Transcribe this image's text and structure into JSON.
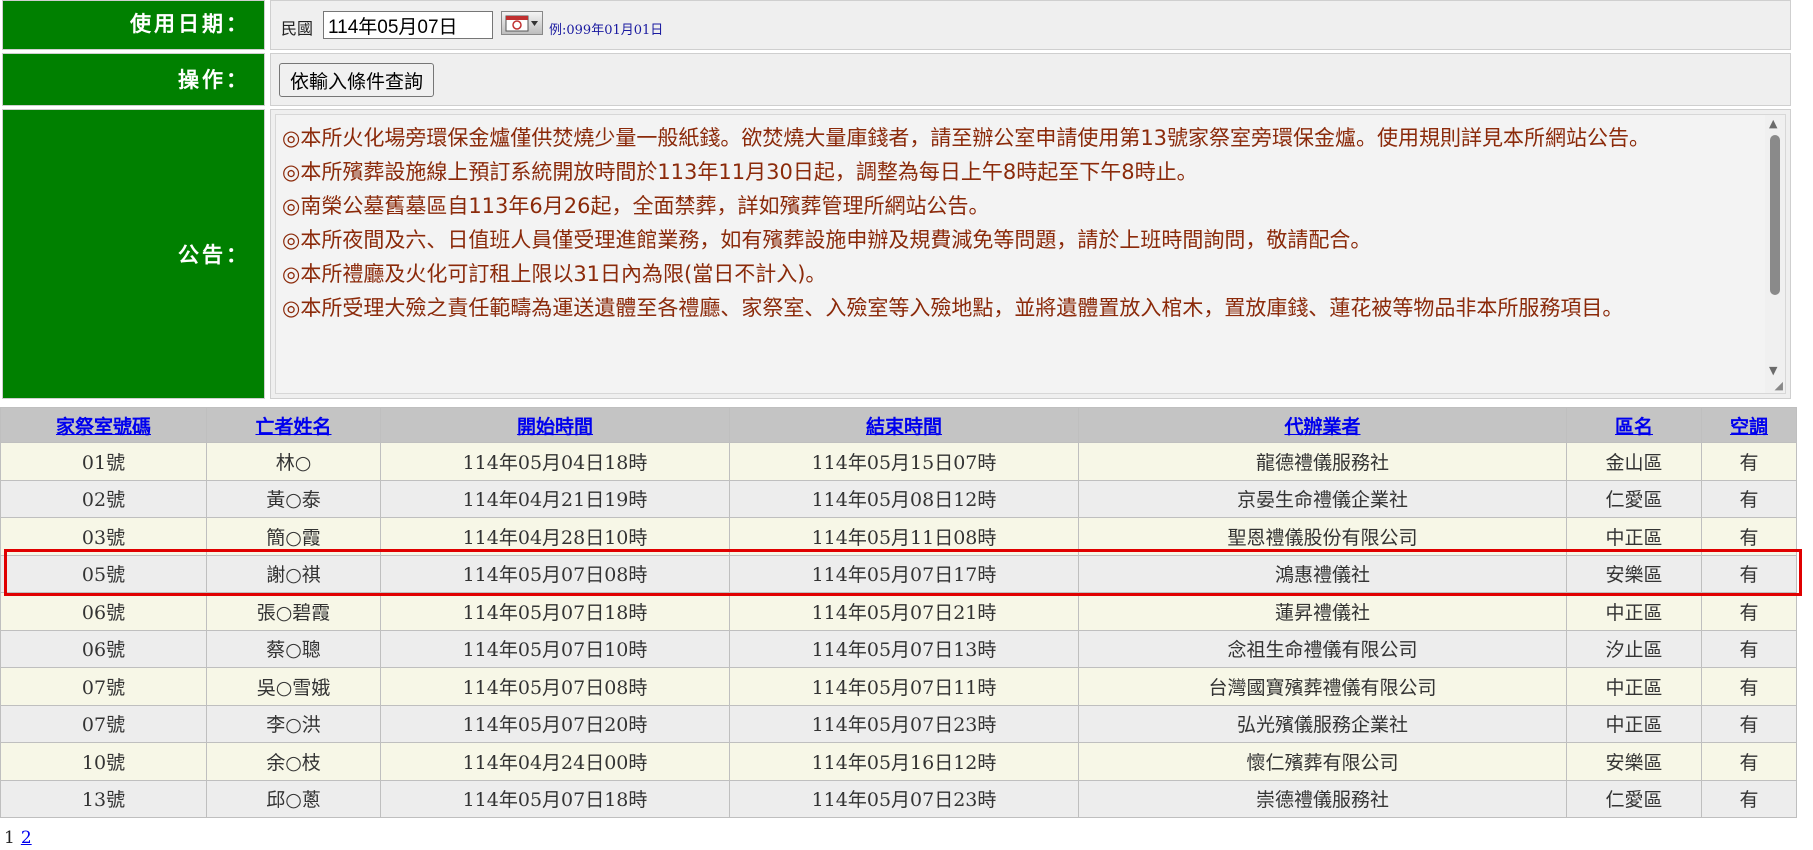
{
  "form": {
    "date_label": "使用日期：",
    "date_prefix": "民國",
    "date_value": "114年05月07日",
    "date_hint": "例:099年01月01日",
    "op_label": "操作：",
    "query_button": "依輸入條件查詢",
    "notice_label": "公告："
  },
  "announcements": [
    "◎本所火化場旁環保金爐僅供焚燒少量一般紙錢。欲焚燒大量庫錢者，請至辦公室申請使用第13號家祭室旁環保金爐。使用規則詳見本所網站公告。",
    "◎本所殯葬設施線上預訂系統開放時間於113年11月30日起，調整為每日上午8時起至下午8時止。",
    "◎南榮公墓舊墓區自113年6月26起，全面禁葬，詳如殯葬管理所網站公告。",
    "◎本所夜間及六、日值班人員僅受理進館業務，如有殯葬設施申辦及規費減免等問題，請於上班時間詢問，敬請配合。",
    "◎本所禮廳及火化可訂租上限以31日內為限(當日不計入)。",
    "◎本所受理大殮之責任範疇為運送遺體至各禮廳、家祭室、入殮室等入殮地點，並將遺體置放入棺木，置放庫錢、蓮花被等物品非本所服務項目。"
  ],
  "table": {
    "headers": [
      "家祭室號碼",
      "亡者姓名",
      "開始時間",
      "結束時間",
      "代辦業者",
      "區名",
      "空調"
    ],
    "rows": [
      [
        "01號",
        "林○",
        "114年05月04日18時",
        "114年05月15日07時",
        "龍德禮儀服務社",
        "金山區",
        "有"
      ],
      [
        "02號",
        "黃○泰",
        "114年04月21日19時",
        "114年05月08日12時",
        "京晏生命禮儀企業社",
        "仁愛區",
        "有"
      ],
      [
        "03號",
        "簡○霞",
        "114年04月28日10時",
        "114年05月11日08時",
        "聖恩禮儀股份有限公司",
        "中正區",
        "有"
      ],
      [
        "05號",
        "謝○祺",
        "114年05月07日08時",
        "114年05月07日17時",
        "鴻惠禮儀社",
        "安樂區",
        "有"
      ],
      [
        "06號",
        "張○碧霞",
        "114年05月07日18時",
        "114年05月07日21時",
        "蓮昇禮儀社",
        "中正區",
        "有"
      ],
      [
        "06號",
        "蔡○聰",
        "114年05月07日10時",
        "114年05月07日13時",
        "念祖生命禮儀有限公司",
        "汐止區",
        "有"
      ],
      [
        "07號",
        "吳○雪娥",
        "114年05月07日08時",
        "114年05月07日11時",
        "台灣國寶殯葬禮儀有限公司",
        "中正區",
        "有"
      ],
      [
        "07號",
        "李○洪",
        "114年05月07日20時",
        "114年05月07日23時",
        "弘光殯儀服務企業社",
        "中正區",
        "有"
      ],
      [
        "10號",
        "余○枝",
        "114年04月24日00時",
        "114年05月16日12時",
        "懷仁殯葬有限公司",
        "安樂區",
        "有"
      ],
      [
        "13號",
        "邱○蔥",
        "114年05月07日18時",
        "114年05月07日23時",
        "崇德禮儀服務社",
        "仁愛區",
        "有"
      ]
    ]
  },
  "pager": {
    "current": "1",
    "next": "2"
  },
  "colors": {
    "label_bg": "#008000",
    "highlight": "#e00000",
    "link": "#0000ee",
    "notice_text": "#8b2a0a"
  },
  "icons": {
    "calendar": "calendar-icon"
  }
}
